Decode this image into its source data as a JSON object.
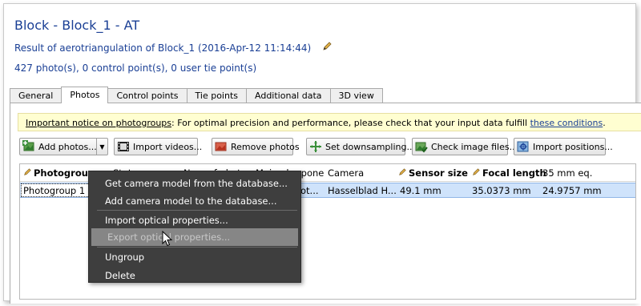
{
  "header": {
    "title": "Block - Block_1 - AT",
    "subtitle": "Result of aerotriangulation of Block_1 (2016-Apr-12 11:14:44)",
    "counts": "427 photo(s), 0 control point(s), 0 user tie point(s)"
  },
  "tabs": [
    {
      "label": "General"
    },
    {
      "label": "Photos"
    },
    {
      "label": "Control points"
    },
    {
      "label": "Tie points"
    },
    {
      "label": "Additional data"
    },
    {
      "label": "3D view"
    }
  ],
  "active_tab": "Photos",
  "notice": {
    "link_label": "Important notice on photogroups",
    "text": ": For optimal precision and performance, please check that your input data fulfill ",
    "conditions_link": "these conditions",
    "end": "."
  },
  "toolbar": {
    "add_photos": "Add photos...",
    "import_videos": "Import videos...",
    "remove_photos": "Remove photos",
    "set_downsampling": "Set downsampling...",
    "check_image_files": "Check image files...",
    "import_positions": "Import positions..."
  },
  "table": {
    "columns": [
      "Photogroup",
      "Stat",
      "Num of ph",
      "Main",
      "Camera",
      "Sensor size",
      "Focal length",
      "35 mm eq."
    ],
    "partial_headers": {
      "stat": "Stat",
      "num": "Num of phot",
      "main": "Main ph...pone"
    },
    "rows": [
      {
        "photogroup": "Photogroup 1",
        "main": "ot...",
        "camera": "Hasselblad H...",
        "sensor_size": "49.1 mm",
        "focal_length": "35.0373 mm",
        "eq35": "24.9757 mm"
      }
    ]
  },
  "context_menu": {
    "items": [
      "Get camera model from the database...",
      "Add camera model to the database...",
      "Import optical properties...",
      "Export optical properties...",
      "Ungroup",
      "Delete"
    ],
    "highlighted_index": 3
  },
  "colors": {
    "title_blue": "#1a3f95",
    "notice_bg": "#fffed1",
    "selection_bg": "#cfe3fb",
    "menu_bg": "#3e3e3e",
    "menu_highlight": "#868686"
  }
}
